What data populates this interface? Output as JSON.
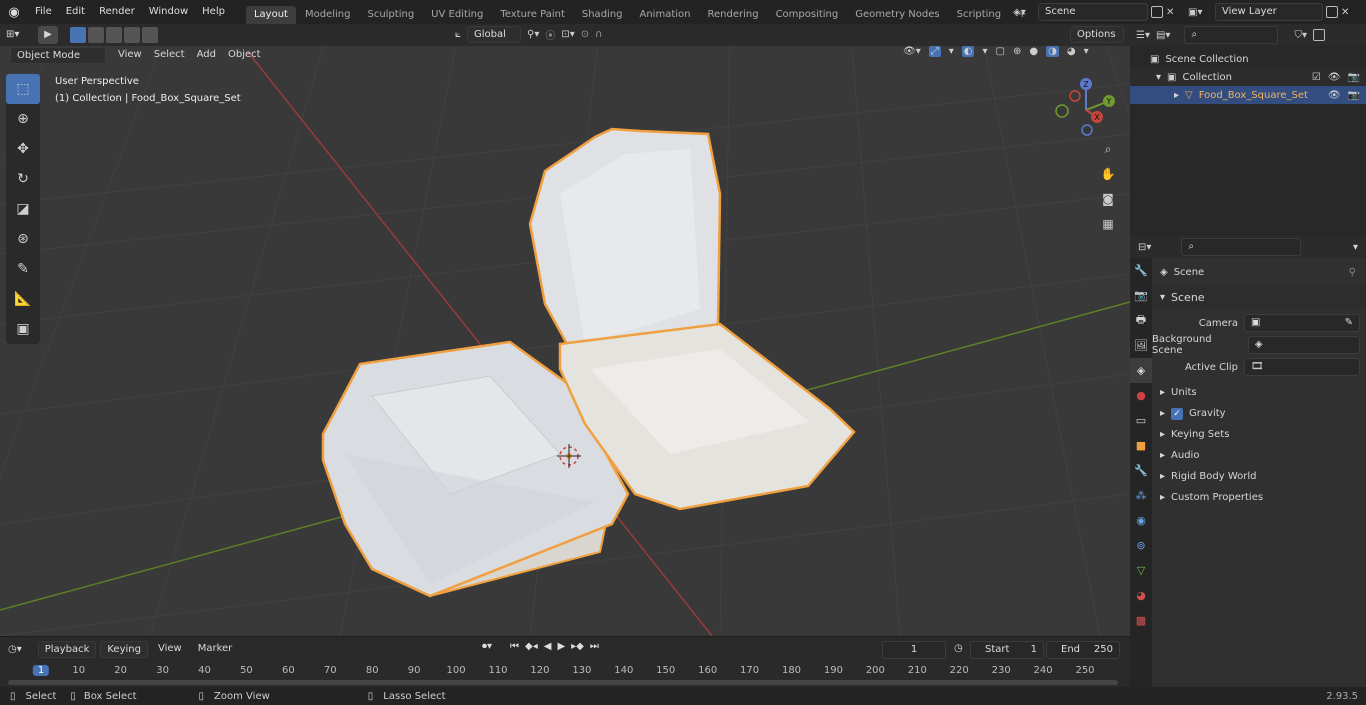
{
  "menu": {
    "file": "File",
    "edit": "Edit",
    "render": "Render",
    "window": "Window",
    "help": "Help"
  },
  "workspaces": [
    "Layout",
    "Modeling",
    "Sculpting",
    "UV Editing",
    "Texture Paint",
    "Shading",
    "Animation",
    "Rendering",
    "Compositing",
    "Geometry Nodes",
    "Scripting"
  ],
  "scene_field": "Scene",
  "view_layer_field": "View Layer",
  "viewport_header": {
    "mode": "Object Mode",
    "view": "View",
    "select": "Select",
    "add": "Add",
    "object": "Object",
    "orientation": "Global",
    "options": "Options"
  },
  "viewport_overlay": {
    "perspective": "User Perspective",
    "collection_info": "(1) Collection | Food_Box_Square_Set"
  },
  "gizmo_axes": {
    "x": "X",
    "y": "Y",
    "z": "Z"
  },
  "outliner": {
    "scene_collection": "Scene Collection",
    "collection": "Collection",
    "object": "Food_Box_Square_Set"
  },
  "properties": {
    "breadcrumb": "Scene",
    "panel_title": "Scene",
    "camera_label": "Camera",
    "background_scene_label": "Background Scene",
    "active_clip_label": "Active Clip",
    "sections": [
      "Units",
      "Gravity",
      "Keying Sets",
      "Audio",
      "Rigid Body World",
      "Custom Properties"
    ]
  },
  "timeline": {
    "playback": "Playback",
    "keying": "Keying",
    "view": "View",
    "marker": "Marker",
    "current_frame": "1",
    "start_label": "Start",
    "start_value": "1",
    "end_label": "End",
    "end_value": "250",
    "ruler": [
      "1",
      "10",
      "20",
      "30",
      "40",
      "50",
      "60",
      "70",
      "80",
      "90",
      "100",
      "110",
      "120",
      "130",
      "140",
      "150",
      "160",
      "170",
      "180",
      "190",
      "200",
      "210",
      "220",
      "230",
      "240",
      "250"
    ]
  },
  "statusbar": {
    "select": "Select",
    "box_select": "Box Select",
    "zoom_view": "Zoom View",
    "lasso_select": "Lasso Select",
    "version": "2.93.5"
  },
  "colors": {
    "accent": "#4772b3",
    "selection_outline": "#f0a040",
    "x_axis": "#b5433f",
    "y_axis": "#6f9a2e"
  }
}
